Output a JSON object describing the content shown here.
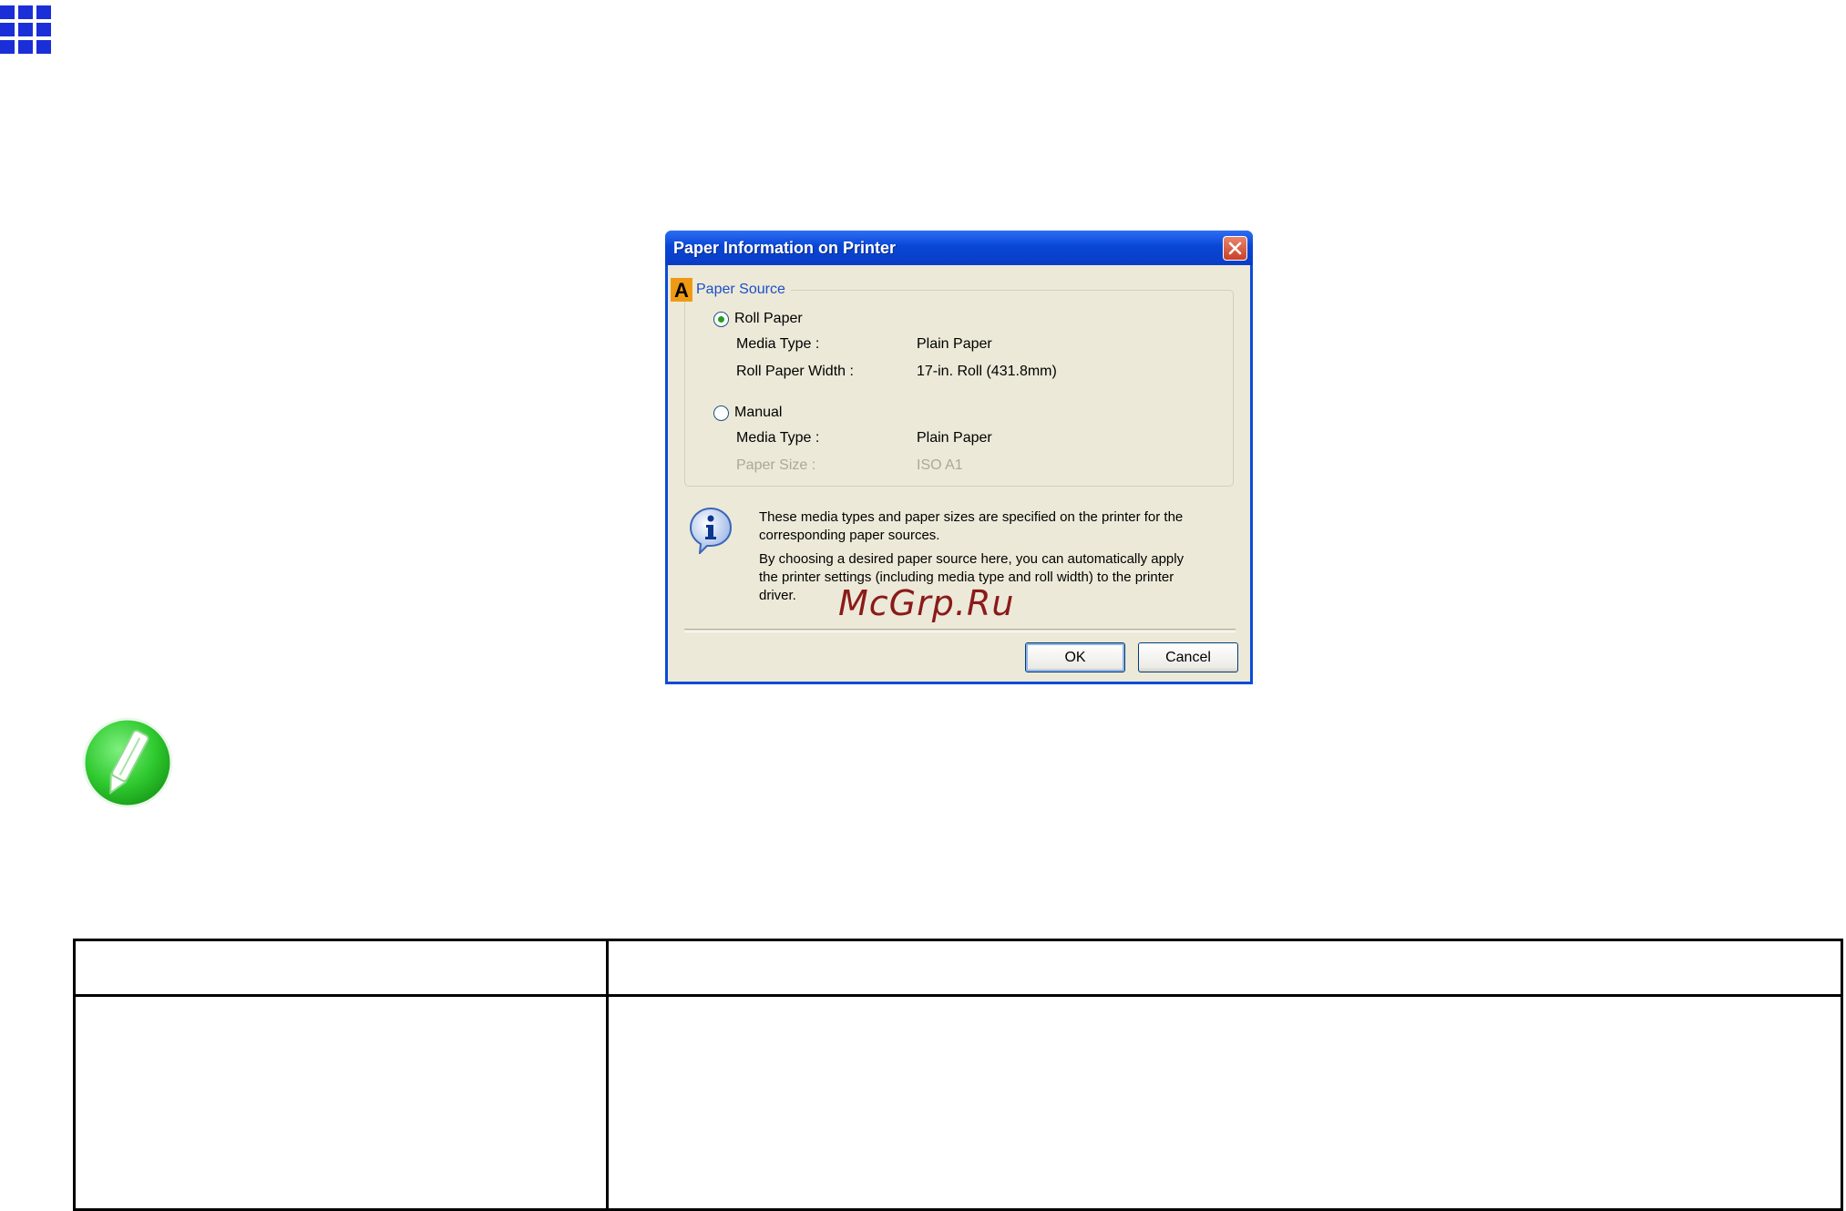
{
  "dialog": {
    "title": "Paper Information on Printer",
    "marker": "A",
    "group_label": "Paper Source",
    "roll": {
      "option_label": "Roll Paper",
      "selected": true,
      "media_type_label": "Media Type :",
      "media_type_value": "Plain Paper",
      "width_label": "Roll Paper Width :",
      "width_value": "17-in. Roll (431.8mm)"
    },
    "manual": {
      "option_label": "Manual",
      "selected": false,
      "media_type_label": "Media Type :",
      "media_type_value": "Plain Paper",
      "size_label": "Paper Size :",
      "size_value": "ISO A1"
    },
    "info_line1": "These media types and paper sizes are specified on the printer for the",
    "info_line2": "corresponding paper sources.",
    "info_line3": "By choosing a desired paper source here, you can automatically apply",
    "info_line4": "the printer settings (including media type and roll width) to the printer",
    "info_line5": "driver.",
    "ok_label": "OK",
    "cancel_label": "Cancel"
  },
  "watermark": "McGrp.Ru",
  "colors": {
    "title_bar": "#0847d6",
    "dialog_bg": "#ece9d8",
    "marker": "#f09a13",
    "grid_icon": "#1a2fd8",
    "note_icon": "#2fc92f",
    "watermark": "#8b1a1a"
  }
}
